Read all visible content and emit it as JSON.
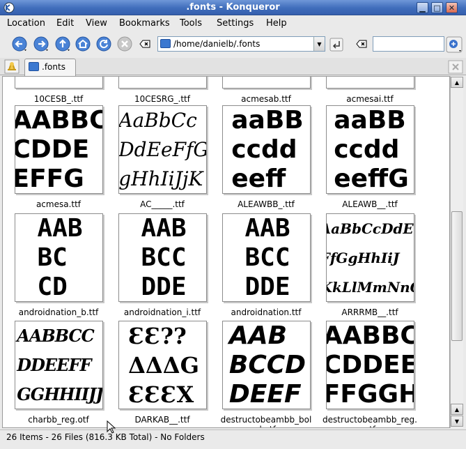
{
  "window": {
    "title": ".fonts - Konqueror"
  },
  "menu": [
    "Location",
    "Edit",
    "View",
    "Bookmarks",
    "Tools",
    "Settings",
    "Help"
  ],
  "toolbar": {
    "location_value": "/home/danielb/.fonts",
    "search_value": ""
  },
  "tab": {
    "label": ".fonts"
  },
  "files": [
    {
      "name": "10CESB_.ttf",
      "preview": "",
      "partial": true
    },
    {
      "name": "10CESRG_.ttf",
      "preview": "",
      "partial": true
    },
    {
      "name": "acmesab.ttf",
      "preview": "",
      "partial": true
    },
    {
      "name": "acmesai.ttf",
      "preview": "",
      "partial": true
    },
    {
      "name": "acmesa.ttf",
      "preview": "AABBC\nCDDE\nEFFG",
      "style": "plain"
    },
    {
      "name": "AC_____.ttf",
      "preview": "AaBbCc\nDdEeFfG\ngHhIiJjK",
      "style": "script"
    },
    {
      "name": "ALEAWBB_.ttf",
      "preview": "aaBB\nccdd\neeff",
      "style": "round"
    },
    {
      "name": "ALEAWB__.ttf",
      "preview": "aaBB\nccdd\neeffG",
      "style": "round"
    },
    {
      "name": "androidnation_b.ttf",
      "preview": "AAB\nBC\nCD",
      "style": "tech"
    },
    {
      "name": "androidnation_i.ttf",
      "preview": "AAB\nBCC\nDDE",
      "style": "tech"
    },
    {
      "name": "androidnation.ttf",
      "preview": "AAB\nBCC\nDDE",
      "style": "tech"
    },
    {
      "name": "ARRRMB__.ttf",
      "preview": "AaBbCcDdEe\nFfGgHhIiJ\nKkLlMmNnO",
      "style": "gothic"
    },
    {
      "name": "charbb_reg.otf",
      "preview": "AABBCC\nDDEEFF\nGGHHIIJJ",
      "style": "flame"
    },
    {
      "name": "DARKAB__.ttf",
      "preview": "ƐƐ??\nΔΔΔG\nƐƐƐX",
      "style": "glyph"
    },
    {
      "name": "destructobeambb_bold.otf",
      "preview": "AAB\nBCCD\nDEEF",
      "style": "heavy"
    },
    {
      "name": "destructobeambb_reg.otf",
      "preview": "AABBC\nCDDEE\nFFGGH",
      "style": "plain"
    }
  ],
  "status": {
    "text": "26 Items - 26 Files (816.3 KB Total) - No Folders"
  }
}
